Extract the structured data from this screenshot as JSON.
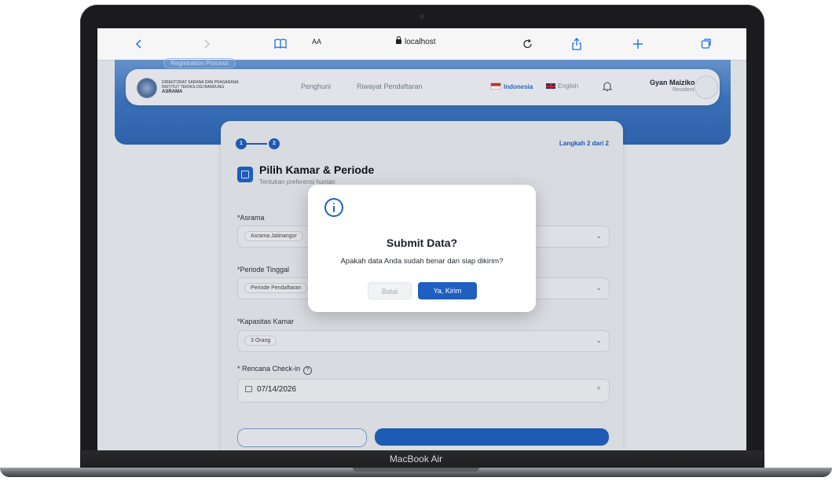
{
  "device": {
    "label": "MacBook Air"
  },
  "browser": {
    "reader_label": "AA",
    "url": "localhost",
    "icons": [
      "back-icon",
      "forward-icon",
      "bookmarks-icon",
      "reload-icon",
      "share-icon",
      "new-tab-icon",
      "tabs-icon"
    ]
  },
  "page": {
    "process_chip": "Registration Process",
    "org": {
      "line1": "DIREKTORAT SARANA DAN PRASARANA",
      "line2": "INSTITUT TEKNOLOGI BANDUNG",
      "line3": "ASRAMA"
    },
    "nav": {
      "links": [
        "Penghuni",
        "Riwayat Pendaftaran"
      ],
      "languages": [
        "Indonesia",
        "English"
      ]
    },
    "user": {
      "name": "Gyan Maiziko",
      "role": "Resident"
    },
    "stepper": {
      "steps": [
        "1",
        "2"
      ],
      "counter": "Langkah 2 dari 2"
    },
    "section": {
      "title": "Pilih Kamar & Periode",
      "subtitle": "Tentukan preferensi hunian"
    },
    "fields": {
      "asrama": {
        "label": "*Asrama",
        "value": "Asrama Jatinangor"
      },
      "periode": {
        "label": "*Periode Tinggal",
        "value": "Periode Pendaftaran"
      },
      "kapasitas": {
        "label": "*Kapasitas Kamar",
        "value": "3 Orang"
      },
      "checkin": {
        "label": "* Rencana Check-in",
        "help": "?",
        "value": "07/14/2026",
        "clear": "×"
      }
    }
  },
  "modal": {
    "title": "Submit Data?",
    "message": "Apakah data Anda sudah benar dan siap dikirim?",
    "cancel_label": "Batal",
    "confirm_label": "Ya, Kirim"
  },
  "colors": {
    "primary": "#1e5fbf",
    "banner": "#3f78c4",
    "text": "#1b1f27"
  }
}
